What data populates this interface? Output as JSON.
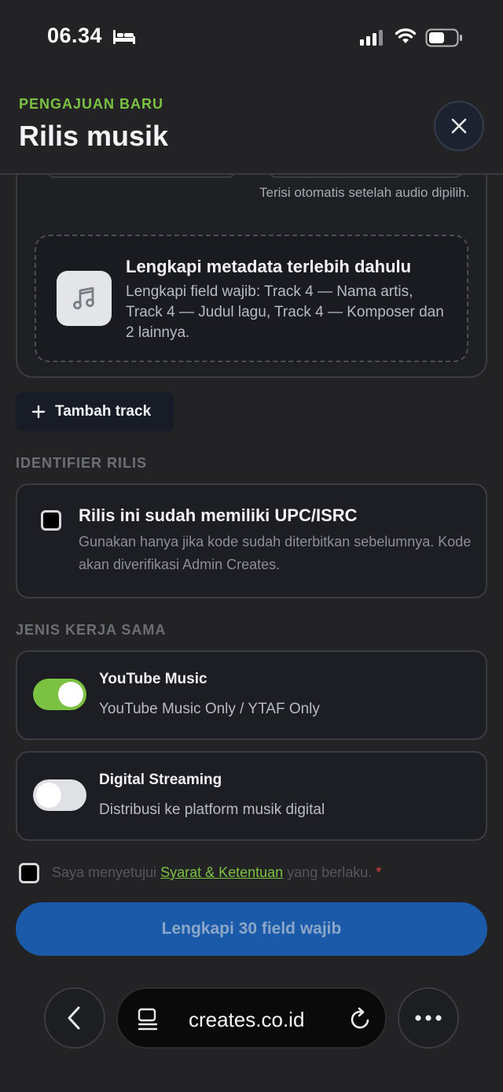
{
  "status_bar": {
    "time": "06.34"
  },
  "header": {
    "eyebrow": "PENGAJUAN BARU",
    "title": "Rilis musik",
    "close_icon": "close-icon"
  },
  "track_card": {
    "autofill_hint": "Terisi otomatis setelah audio dipilih.",
    "metadata_notice": {
      "icon": "music-note-icon",
      "title": "Lengkapi metadata terlebih dahulu",
      "description": "Lengkapi field wajib: Track 4 — Nama artis, Track 4 — Judul lagu, Track 4 — Komposer dan 2 lainnya."
    }
  },
  "add_track": {
    "label": "Tambah track",
    "icon": "plus-icon"
  },
  "identifier_section": {
    "label": "IDENTIFIER RILIS",
    "option": {
      "title": "Rilis ini sudah memiliki UPC/ISRC",
      "description": "Gunakan hanya jika kode sudah diterbitkan sebelumnya. Kode akan diverifikasi Admin Creates.",
      "checked": false
    }
  },
  "partnership_section": {
    "label": "JENIS KERJA SAMA",
    "options": [
      {
        "title": "YouTube Music",
        "description": "YouTube Music Only / YTAF Only",
        "enabled": true
      },
      {
        "title": "Digital Streaming",
        "description": "Distribusi ke platform musik digital",
        "enabled": false
      }
    ]
  },
  "terms": {
    "prefix": "Saya menyetujui ",
    "link": "Syarat & Ketentuan",
    "suffix": " yang berlaku. ",
    "required_mark": "*",
    "checked": false
  },
  "submit": {
    "label": "Lengkapi 30 field wajib"
  },
  "browser": {
    "url": "creates.co.id"
  },
  "colors": {
    "accent_green": "#7cc242",
    "primary_blue": "#1a5aa8",
    "background": "#232326"
  }
}
